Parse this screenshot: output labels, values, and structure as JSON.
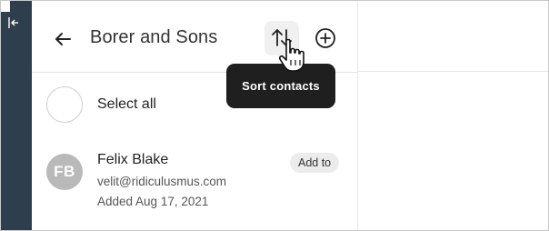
{
  "sidebar": {
    "toggle_icon": "collapse-sidebar-icon",
    "color": "#2f3e4d"
  },
  "header": {
    "back_icon": "arrow-left-icon",
    "title": "Borer and Sons",
    "sort_icon": "sort-arrows-icon",
    "add_icon": "plus-circle-icon"
  },
  "tooltip": {
    "text": "Sort contacts"
  },
  "select_all": {
    "label": "Select all"
  },
  "contacts": [
    {
      "initials": "FB",
      "name": "Felix Blake",
      "email": "velit@ridiculusmus.com",
      "added": "Added Aug 17, 2021",
      "action_label": "Add to"
    }
  ],
  "cursor": {
    "icon": "hand-pointer-icon"
  }
}
